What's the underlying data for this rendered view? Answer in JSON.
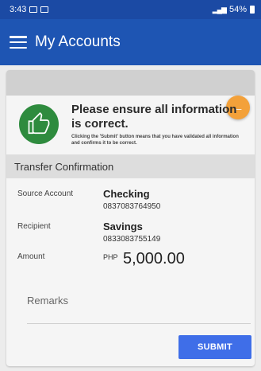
{
  "status_bar": {
    "time": "3:43",
    "battery": "54%"
  },
  "app_bar": {
    "title": "My Accounts"
  },
  "notice": {
    "title": "Please ensure all information is correct.",
    "subtitle": "Clicking the 'Submit' button means that you have validated all information and confirms it to be correct."
  },
  "section": {
    "title": "Transfer Confirmation"
  },
  "source": {
    "label": "Source Account",
    "name": "Checking",
    "number": "0837083764950"
  },
  "recipient": {
    "label": "Recipient",
    "name": "Savings",
    "number": "0833083755149"
  },
  "amount": {
    "label": "Amount",
    "currency": "PHP",
    "value": "5,000.00"
  },
  "remarks_label": "Remarks",
  "submit_label": "SUBMIT",
  "colors": {
    "primary": "#1e55b3",
    "accent": "#f3a13a",
    "badge": "#2e8b3e",
    "button": "#3f6ee8"
  },
  "icons": [
    "menu-icon",
    "back-arrow-icon",
    "thumbs-up-icon"
  ]
}
